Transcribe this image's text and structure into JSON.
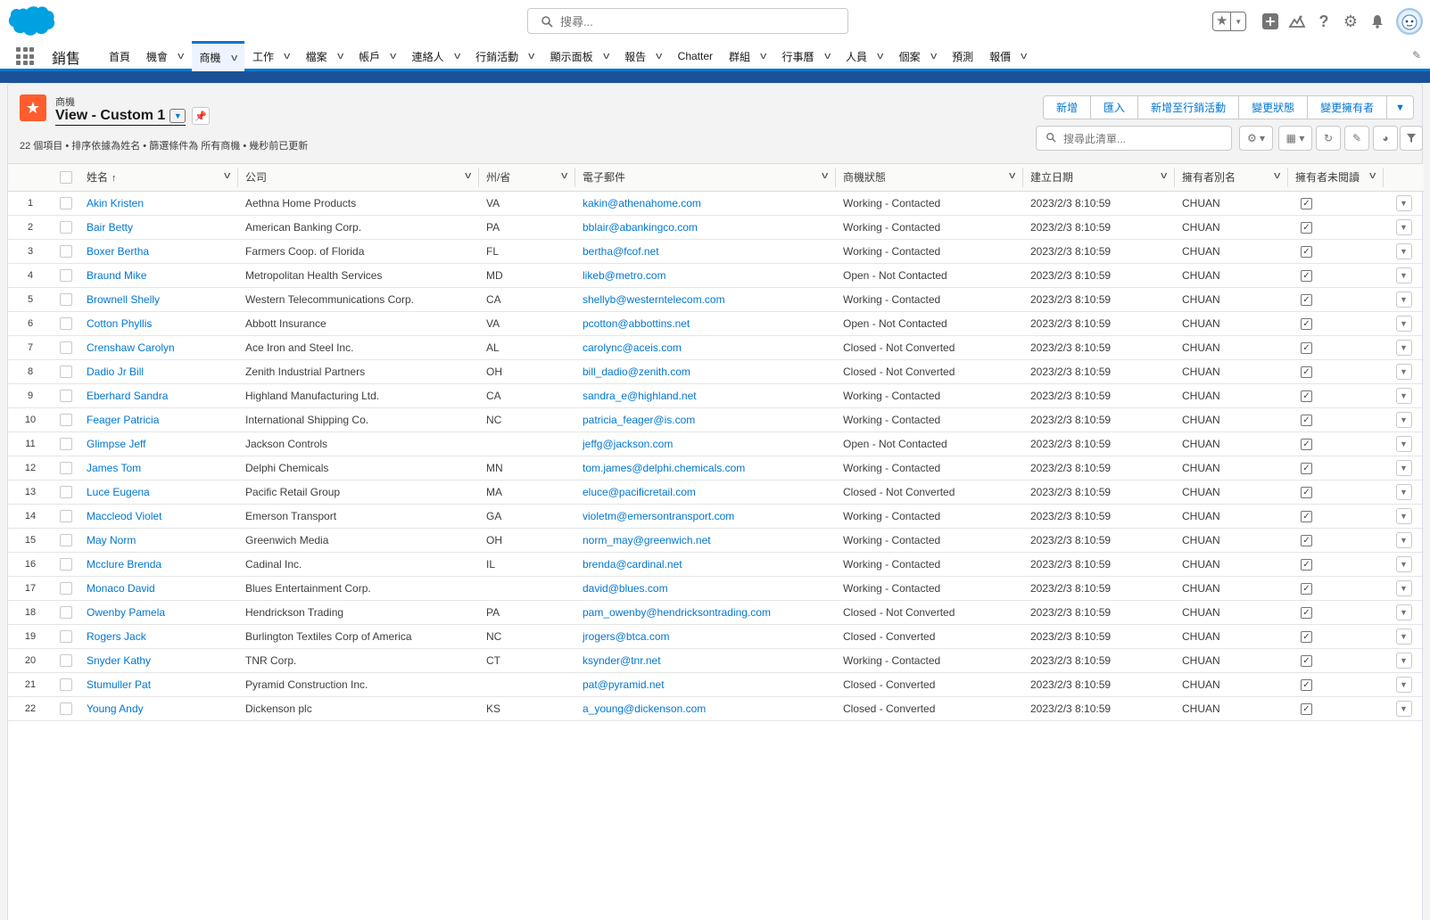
{
  "global": {
    "search_placeholder": "搜尋..."
  },
  "nav": {
    "app_name": "銷售",
    "items": [
      {
        "label": "首頁",
        "chevron": false,
        "active": false
      },
      {
        "label": "機會",
        "chevron": true,
        "active": false
      },
      {
        "label": "商機",
        "chevron": true,
        "active": true
      },
      {
        "label": "工作",
        "chevron": true,
        "active": false
      },
      {
        "label": "檔案",
        "chevron": true,
        "active": false
      },
      {
        "label": "帳戶",
        "chevron": true,
        "active": false
      },
      {
        "label": "連絡人",
        "chevron": true,
        "active": false
      },
      {
        "label": "行銷活動",
        "chevron": true,
        "active": false
      },
      {
        "label": "顯示面板",
        "chevron": true,
        "active": false
      },
      {
        "label": "報告",
        "chevron": true,
        "active": false
      },
      {
        "label": "Chatter",
        "chevron": false,
        "active": false
      },
      {
        "label": "群組",
        "chevron": true,
        "active": false
      },
      {
        "label": "行事曆",
        "chevron": true,
        "active": false
      },
      {
        "label": "人員",
        "chevron": true,
        "active": false
      },
      {
        "label": "個案",
        "chevron": true,
        "active": false
      },
      {
        "label": "預測",
        "chevron": false,
        "active": false
      },
      {
        "label": "報價",
        "chevron": true,
        "active": false
      }
    ]
  },
  "list": {
    "object_label": "商機",
    "view_name": "View - Custom 1",
    "meta": "22 個項目 • 排序依據為姓名 • 篩選條件為 所有商機 • 幾秒前已更新",
    "buttons": [
      "新增",
      "匯入",
      "新增至行銷活動",
      "變更狀態",
      "變更擁有者"
    ],
    "search_placeholder": "搜尋此清單..."
  },
  "table": {
    "columns": [
      "姓名",
      "公司",
      "州/省",
      "電子郵件",
      "商機狀態",
      "建立日期",
      "擁有者別名",
      "擁有者未閱讀"
    ],
    "rows": [
      {
        "n": "1",
        "name": "Akin Kristen",
        "company": "Aethna Home Products",
        "state": "VA",
        "email": "kakin@athenahome.com",
        "status": "Working - Contacted",
        "date": "2023/2/3 8:10:59",
        "alias": "CHUAN"
      },
      {
        "n": "2",
        "name": "Bair Betty",
        "company": "American Banking Corp.",
        "state": "PA",
        "email": "bblair@abankingco.com",
        "status": "Working - Contacted",
        "date": "2023/2/3 8:10:59",
        "alias": "CHUAN"
      },
      {
        "n": "3",
        "name": "Boxer Bertha",
        "company": "Farmers Coop. of Florida",
        "state": "FL",
        "email": "bertha@fcof.net",
        "status": "Working - Contacted",
        "date": "2023/2/3 8:10:59",
        "alias": "CHUAN"
      },
      {
        "n": "4",
        "name": "Braund Mike",
        "company": "Metropolitan Health Services",
        "state": "MD",
        "email": "likeb@metro.com",
        "status": "Open - Not Contacted",
        "date": "2023/2/3 8:10:59",
        "alias": "CHUAN"
      },
      {
        "n": "5",
        "name": "Brownell Shelly",
        "company": "Western Telecommunications Corp.",
        "state": "CA",
        "email": "shellyb@westerntelecom.com",
        "status": "Working - Contacted",
        "date": "2023/2/3 8:10:59",
        "alias": "CHUAN"
      },
      {
        "n": "6",
        "name": "Cotton Phyllis",
        "company": "Abbott Insurance",
        "state": "VA",
        "email": "pcotton@abbottins.net",
        "status": "Open - Not Contacted",
        "date": "2023/2/3 8:10:59",
        "alias": "CHUAN"
      },
      {
        "n": "7",
        "name": "Crenshaw Carolyn",
        "company": "Ace Iron and Steel Inc.",
        "state": "AL",
        "email": "carolync@aceis.com",
        "status": "Closed - Not Converted",
        "date": "2023/2/3 8:10:59",
        "alias": "CHUAN"
      },
      {
        "n": "8",
        "name": "Dadio Jr Bill",
        "company": "Zenith Industrial Partners",
        "state": "OH",
        "email": "bill_dadio@zenith.com",
        "status": "Closed - Not Converted",
        "date": "2023/2/3 8:10:59",
        "alias": "CHUAN"
      },
      {
        "n": "9",
        "name": "Eberhard Sandra",
        "company": "Highland Manufacturing Ltd.",
        "state": "CA",
        "email": "sandra_e@highland.net",
        "status": "Working - Contacted",
        "date": "2023/2/3 8:10:59",
        "alias": "CHUAN"
      },
      {
        "n": "10",
        "name": "Feager Patricia",
        "company": "International Shipping Co.",
        "state": "NC",
        "email": "patricia_feager@is.com",
        "status": "Working - Contacted",
        "date": "2023/2/3 8:10:59",
        "alias": "CHUAN"
      },
      {
        "n": "11",
        "name": "Glimpse Jeff",
        "company": "Jackson Controls",
        "state": "",
        "email": "jeffg@jackson.com",
        "status": "Open - Not Contacted",
        "date": "2023/2/3 8:10:59",
        "alias": "CHUAN"
      },
      {
        "n": "12",
        "name": "James Tom",
        "company": "Delphi Chemicals",
        "state": "MN",
        "email": "tom.james@delphi.chemicals.com",
        "status": "Working - Contacted",
        "date": "2023/2/3 8:10:59",
        "alias": "CHUAN"
      },
      {
        "n": "13",
        "name": "Luce Eugena",
        "company": "Pacific Retail Group",
        "state": "MA",
        "email": "eluce@pacificretail.com",
        "status": "Closed - Not Converted",
        "date": "2023/2/3 8:10:59",
        "alias": "CHUAN"
      },
      {
        "n": "14",
        "name": "Maccleod Violet",
        "company": "Emerson Transport",
        "state": "GA",
        "email": "violetm@emersontransport.com",
        "status": "Working - Contacted",
        "date": "2023/2/3 8:10:59",
        "alias": "CHUAN"
      },
      {
        "n": "15",
        "name": "May Norm",
        "company": "Greenwich Media",
        "state": "OH",
        "email": "norm_may@greenwich.net",
        "status": "Working - Contacted",
        "date": "2023/2/3 8:10:59",
        "alias": "CHUAN"
      },
      {
        "n": "16",
        "name": "Mcclure Brenda",
        "company": "Cadinal Inc.",
        "state": "IL",
        "email": "brenda@cardinal.net",
        "status": "Working - Contacted",
        "date": "2023/2/3 8:10:59",
        "alias": "CHUAN"
      },
      {
        "n": "17",
        "name": "Monaco David",
        "company": "Blues Entertainment Corp.",
        "state": "",
        "email": "david@blues.com",
        "status": "Working - Contacted",
        "date": "2023/2/3 8:10:59",
        "alias": "CHUAN"
      },
      {
        "n": "18",
        "name": "Owenby Pamela",
        "company": "Hendrickson Trading",
        "state": "PA",
        "email": "pam_owenby@hendricksontrading.com",
        "status": "Closed - Not Converted",
        "date": "2023/2/3 8:10:59",
        "alias": "CHUAN"
      },
      {
        "n": "19",
        "name": "Rogers Jack",
        "company": "Burlington Textiles Corp of America",
        "state": "NC",
        "email": "jrogers@btca.com",
        "status": "Closed - Converted",
        "date": "2023/2/3 8:10:59",
        "alias": "CHUAN"
      },
      {
        "n": "20",
        "name": "Snyder Kathy",
        "company": "TNR Corp.",
        "state": "CT",
        "email": "ksynder@tnr.net",
        "status": "Working - Contacted",
        "date": "2023/2/3 8:10:59",
        "alias": "CHUAN"
      },
      {
        "n": "21",
        "name": "Stumuller Pat",
        "company": "Pyramid Construction Inc.",
        "state": "",
        "email": "pat@pyramid.net",
        "status": "Closed - Converted",
        "date": "2023/2/3 8:10:59",
        "alias": "CHUAN"
      },
      {
        "n": "22",
        "name": "Young Andy",
        "company": "Dickenson plc",
        "state": "KS",
        "email": "a_young@dickenson.com",
        "status": "Closed - Converted",
        "date": "2023/2/3 8:10:59",
        "alias": "CHUAN"
      }
    ]
  },
  "colors": {
    "brand_blue": "#0176d3",
    "band_blue": "#1b5297",
    "object_icon": "#ff5d2d",
    "logo_blue": "#00a1e0"
  },
  "icons": {
    "logo": "salesforce-cloud-logo",
    "search": "search-icon",
    "favorites": "star-icon",
    "add": "plus-icon",
    "trailhead": "trailhead-icon",
    "help": "question-icon",
    "settings": "gear-icon",
    "notifications": "bell-icon"
  }
}
